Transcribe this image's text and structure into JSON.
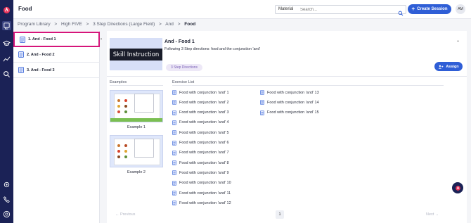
{
  "header": {
    "title": "Food",
    "material_select": "Material",
    "search_placeholder": "Search...",
    "create_label": "Create Session",
    "avatar_initials": "AM"
  },
  "breadcrumb": [
    "Program Library",
    ">",
    "High FIVE",
    ">",
    "3 Step Directions (Large Field)",
    ">",
    "And",
    ">",
    "Food"
  ],
  "list": [
    {
      "label": "1. And - Food 1"
    },
    {
      "label": "2. And - Food 2"
    },
    {
      "label": "3. And - Food 3"
    }
  ],
  "lesson": {
    "thumb_text": "Skill Instruction",
    "title": "And - Food 1",
    "description": "Following 3 Step directions: food and the conjunction 'and'",
    "tag": "3 Step Directions",
    "assign_label": "Assign"
  },
  "sections": {
    "examples_label": "Examples",
    "exercise_label": "Exercise List"
  },
  "examples": [
    {
      "label": "Example 1"
    },
    {
      "label": "Example 2"
    }
  ],
  "exercises": [
    "Food with conjunction 'and' 1",
    "Food with conjunction 'and' 2",
    "Food with conjunction 'and' 3",
    "Food with conjunction 'and' 4",
    "Food with conjunction 'and' 5",
    "Food with conjunction 'and' 6",
    "Food with conjunction 'and' 7",
    "Food with conjunction 'and' 8",
    "Food with conjunction 'and' 9",
    "Food with conjunction 'and' 10",
    "Food with conjunction 'and' 11",
    "Food with conjunction 'and' 12",
    "Food with conjunction 'and' 13",
    "Food with conjunction 'and' 14",
    "Food with conjunction 'and' 15"
  ],
  "pager": {
    "prev": "← Previous",
    "page": "1",
    "next": "Next →"
  },
  "colors": {
    "rail": "#1b2256",
    "accent": "#2f5ed6",
    "active_outline": "#d5157a",
    "tag_bg": "#ede8f7"
  }
}
